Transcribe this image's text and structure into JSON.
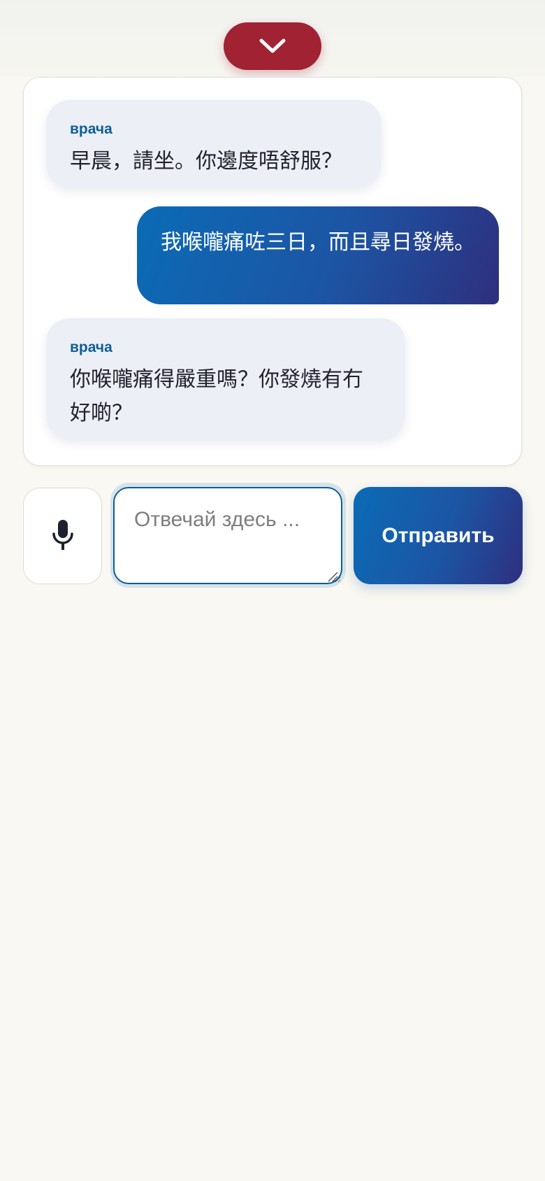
{
  "collapse": {
    "icon": "chevron-down-icon",
    "color": "#a02233"
  },
  "messages": [
    {
      "role": "doctor",
      "sender": "врача",
      "text": "早晨，請坐。你邊度唔舒服？"
    },
    {
      "role": "user",
      "sender": "",
      "text": "我喉嚨痛咗三日，而且尋日發燒。"
    },
    {
      "role": "doctor",
      "sender": "врача",
      "text": "你喉嚨痛得嚴重嗎？你發燒有冇好啲？"
    }
  ],
  "composer": {
    "mic_icon": "microphone-icon",
    "reply_value": "",
    "reply_placeholder": "Отвечай здесь ...",
    "send_label": "Отправить"
  },
  "colors": {
    "accent_red": "#a02233",
    "sender_label": "#0d5e97",
    "doctor_bubble": "#edeff7",
    "user_bubble_start": "#0b6bb6",
    "user_bubble_end": "#2e2f7e",
    "background": "#f9f8f2"
  }
}
